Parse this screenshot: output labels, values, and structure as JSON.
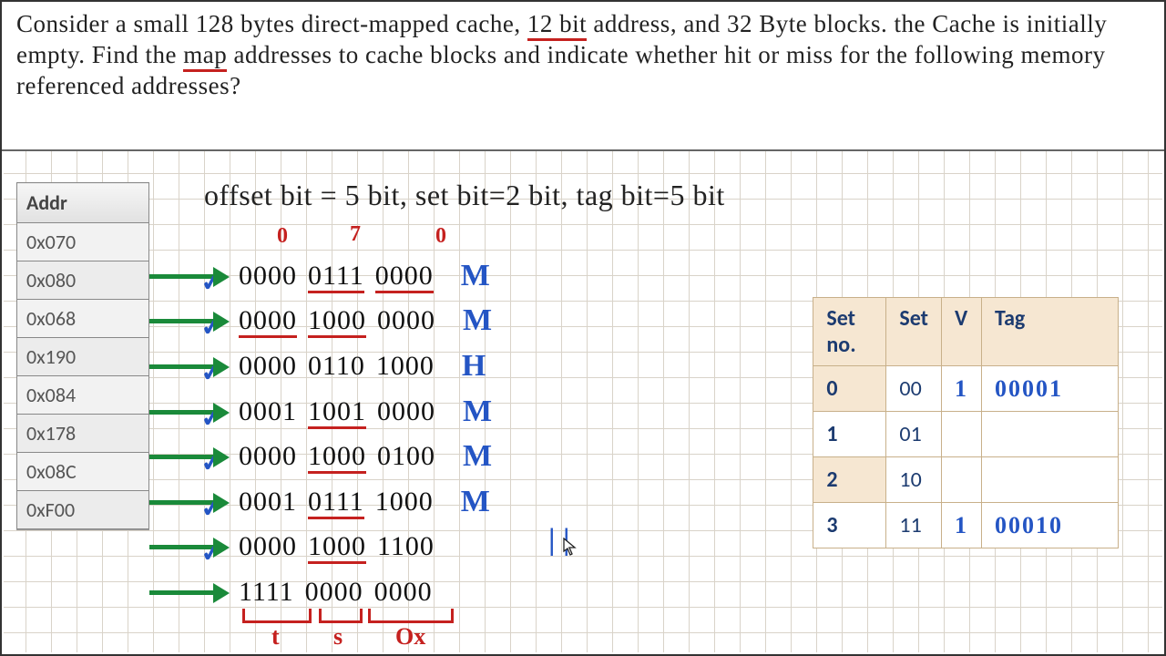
{
  "question": {
    "pre_bit": "Consider a small 128 bytes direct-mapped cache, ",
    "bit": "12 bit",
    "mid1": " address, and 32 Byte blocks. the Cache is initially empty. Find the ",
    "map": "map",
    "post_map": " addresses to cache blocks and indicate whether hit or miss for the following memory referenced addresses?"
  },
  "offset_line": "offset bit = 5 bit, set bit=2 bit, tag bit=5 bit",
  "addr_header": "Addr",
  "addresses": [
    "0x070",
    "0x080",
    "0x068",
    "0x190",
    "0x084",
    "0x178",
    "0x08C",
    "0xF00"
  ],
  "hex_notes": {
    "a": "0",
    "b": "7",
    "c": "0"
  },
  "rows": [
    {
      "g1": "0000",
      "g2": "0111",
      "g3": "0000",
      "ul2": true,
      "ul3": true,
      "result": "M"
    },
    {
      "g1": "0000",
      "g2": "1000",
      "g3": "0000",
      "ul1": true,
      "ul2": true,
      "result": "M"
    },
    {
      "g1": "0000",
      "g2": "0110",
      "g3": "1000",
      "result": "H"
    },
    {
      "g1": "0001",
      "g2": "1001",
      "g3": "0000",
      "ul2": true,
      "result": "M"
    },
    {
      "g1": "0000",
      "g2": "1000",
      "g3": "0100",
      "ul2": true,
      "result": "M"
    },
    {
      "g1": "0001",
      "g2": "0111",
      "g3": "1000",
      "ul2": true,
      "result": "M"
    },
    {
      "g1": "0000",
      "g2": "1000",
      "g3": "1100",
      "ul2": true,
      "result": ""
    },
    {
      "g1": "1111",
      "g2": "0000",
      "g3": "0000",
      "result": ""
    }
  ],
  "bottom_labels": {
    "t": "t",
    "s": "s",
    "ox": "Ox"
  },
  "cache": {
    "headers": [
      "Set no.",
      "Set",
      "V",
      "Tag"
    ],
    "rows": [
      {
        "no": "0",
        "set": "00",
        "v": "1",
        "tag": "00001"
      },
      {
        "no": "1",
        "set": "01",
        "v": "",
        "tag": ""
      },
      {
        "no": "2",
        "set": "10",
        "v": "",
        "tag": ""
      },
      {
        "no": "3",
        "set": "11",
        "v": "1",
        "tag": "00010"
      }
    ]
  }
}
